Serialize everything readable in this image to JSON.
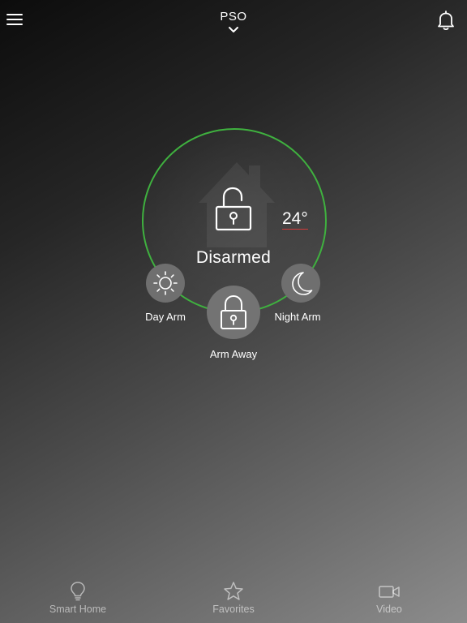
{
  "header": {
    "title": "PSO"
  },
  "status": {
    "label": "Disarmed",
    "temperature": "24°",
    "ring_color": "#3fb13f",
    "state": "disarmed"
  },
  "arm_options": {
    "day": {
      "label": "Day Arm",
      "icon": "sun-icon"
    },
    "night": {
      "label": "Night Arm",
      "icon": "moon-icon"
    },
    "away": {
      "label": "Arm Away",
      "icon": "lock-icon"
    }
  },
  "bottom_nav": [
    {
      "label": "Smart Home",
      "icon": "lightbulb-icon"
    },
    {
      "label": "Favorites",
      "icon": "star-icon"
    },
    {
      "label": "Video",
      "icon": "video-camera-icon"
    }
  ],
  "icons": {
    "menu": "hamburger-menu-icon",
    "title_toggle": "chevron-down-icon",
    "notifications": "bell-icon"
  }
}
